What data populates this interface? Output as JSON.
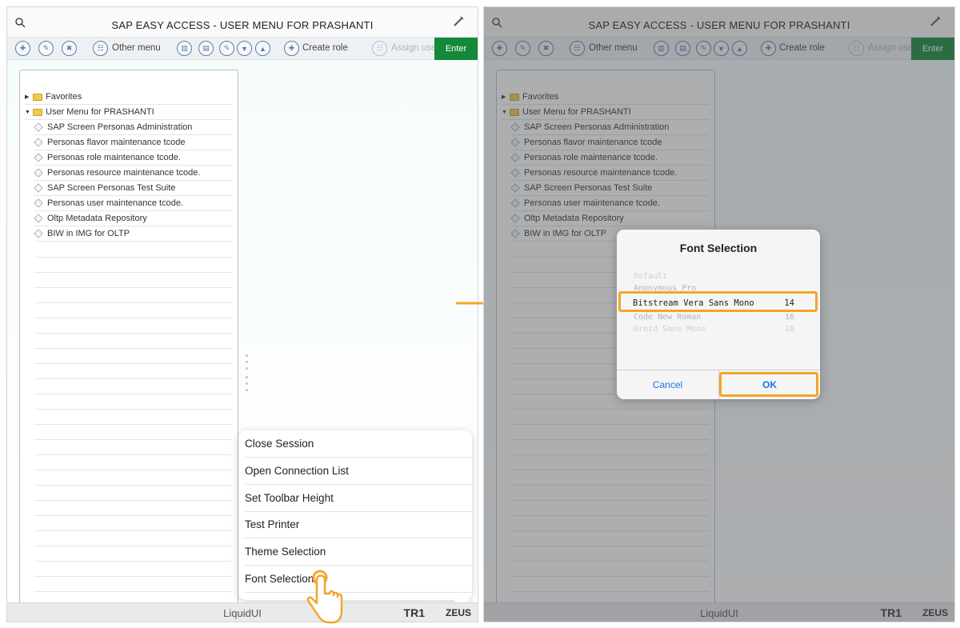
{
  "left": {
    "title": "SAP EASY ACCESS  -  USER MENU FOR PRASHANTI",
    "toolbar": {
      "other_menu": "Other menu",
      "create_role": "Create role",
      "assign_user": "Assign use",
      "enter": "Enter"
    },
    "tree": {
      "favorites": "Favorites",
      "user_menu": "User Menu for PRASHANTI",
      "items": [
        "SAP Screen Personas Administration",
        "Personas flavor maintenance tcode",
        "Personas role maintenance tcode.",
        "Personas resource maintenance tcode.",
        "SAP Screen Personas Test Suite",
        "Personas user maintenance tcode.",
        "Oltp Metadata Repository",
        "BIW in IMG for OLTP"
      ]
    },
    "menu": [
      "Close Session",
      "Open Connection List",
      "Set Toolbar Height",
      "Test Printer",
      "Theme Selection",
      "Font Selection"
    ],
    "bottombar": {
      "brand": "LiquidUI",
      "system": "TR1",
      "host": "ZEUS"
    }
  },
  "right": {
    "title": "SAP EASY ACCESS  -  USER MENU FOR PRASHANTI",
    "toolbar": {
      "other_menu": "Other menu",
      "create_role": "Create role",
      "assign_user": "Assign use",
      "enter": "Enter"
    },
    "tree": {
      "favorites": "Favorites",
      "user_menu": "User Menu for PRASHANTI",
      "items": [
        "SAP Screen Personas Administration",
        "Personas flavor maintenance tcode",
        "Personas role maintenance tcode.",
        "Personas resource maintenance tcode.",
        "SAP Screen Personas Test Suite",
        "Personas user maintenance tcode.",
        "Oltp Metadata Repository",
        "BIW in IMG for OLTP"
      ]
    },
    "dialog": {
      "title": "Font Selection",
      "fonts": [
        {
          "name": "Default",
          "size": ""
        },
        {
          "name": "Anonymous Pro",
          "size": ""
        },
        {
          "name": "Bitstream Vera Sans Mono",
          "size": "14"
        },
        {
          "name": "Code New Roman",
          "size": "16"
        },
        {
          "name": "Droid Sans Mono",
          "size": "18"
        }
      ],
      "cancel": "Cancel",
      "ok": "OK"
    },
    "bottombar": {
      "brand": "LiquidUI",
      "system": "TR1",
      "host": "ZEUS"
    }
  },
  "colors": {
    "enter_green": "#14893a",
    "highlight_orange": "#f4a52a",
    "ios_blue": "#1a73e8",
    "folder_yellow": "#f2c94c"
  }
}
